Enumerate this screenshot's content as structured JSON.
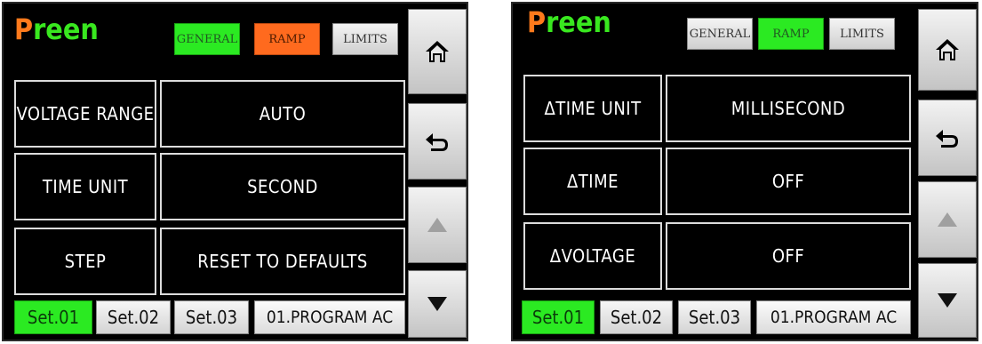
{
  "brand": {
    "first": "P",
    "rest": "reen"
  },
  "colors": {
    "green": "#2bea22",
    "orange": "#ff6a1e",
    "screen_bg": "#000000"
  },
  "screens": {
    "left": {
      "tabs": [
        "GENERAL",
        "RAMP",
        "LIMITS"
      ],
      "rows": [
        {
          "label": "VOLTAGE RANGE",
          "value": "AUTO"
        },
        {
          "label": "TIME UNIT",
          "value": "SECOND"
        },
        {
          "label": "STEP",
          "value": "RESET TO DEFAULTS"
        }
      ],
      "sets": [
        "Set.01",
        "Set.02",
        "Set.03"
      ],
      "program": "01.PROGRAM AC",
      "side_icons": [
        "home-icon",
        "back-arrow-icon",
        "triangle-up-icon",
        "triangle-down-icon"
      ]
    },
    "right": {
      "tabs": [
        "GENERAL",
        "RAMP",
        "LIMITS"
      ],
      "rows": [
        {
          "label": "ΔTIME UNIT",
          "value": "MILLISECOND"
        },
        {
          "label": "ΔTIME",
          "value": "OFF"
        },
        {
          "label": "ΔVOLTAGE",
          "value": "OFF"
        }
      ],
      "sets": [
        "Set.01",
        "Set.02",
        "Set.03"
      ],
      "program": "01.PROGRAM AC",
      "side_icons": [
        "home-icon",
        "back-arrow-icon",
        "triangle-up-icon",
        "triangle-down-icon"
      ]
    }
  }
}
